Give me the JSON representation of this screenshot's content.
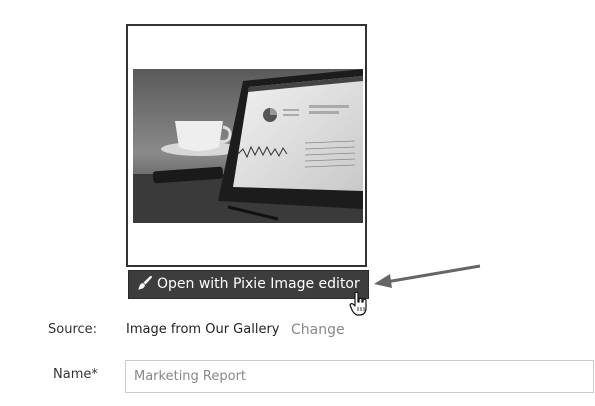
{
  "editor_button": {
    "label": "Open with Pixie Image editor",
    "icon": "paint-brush-icon"
  },
  "image": {
    "description_icon": "image-preview"
  },
  "form": {
    "source_label": "Source:",
    "source_value": "Image from Our Gallery",
    "change_label": "Change",
    "name_label": "Name*",
    "name_value": "",
    "name_placeholder": "Marketing Report"
  },
  "colors": {
    "button_bg": "#3d3d3d",
    "button_text": "#ffffff",
    "link": "#888888",
    "frame_border": "#333333"
  }
}
